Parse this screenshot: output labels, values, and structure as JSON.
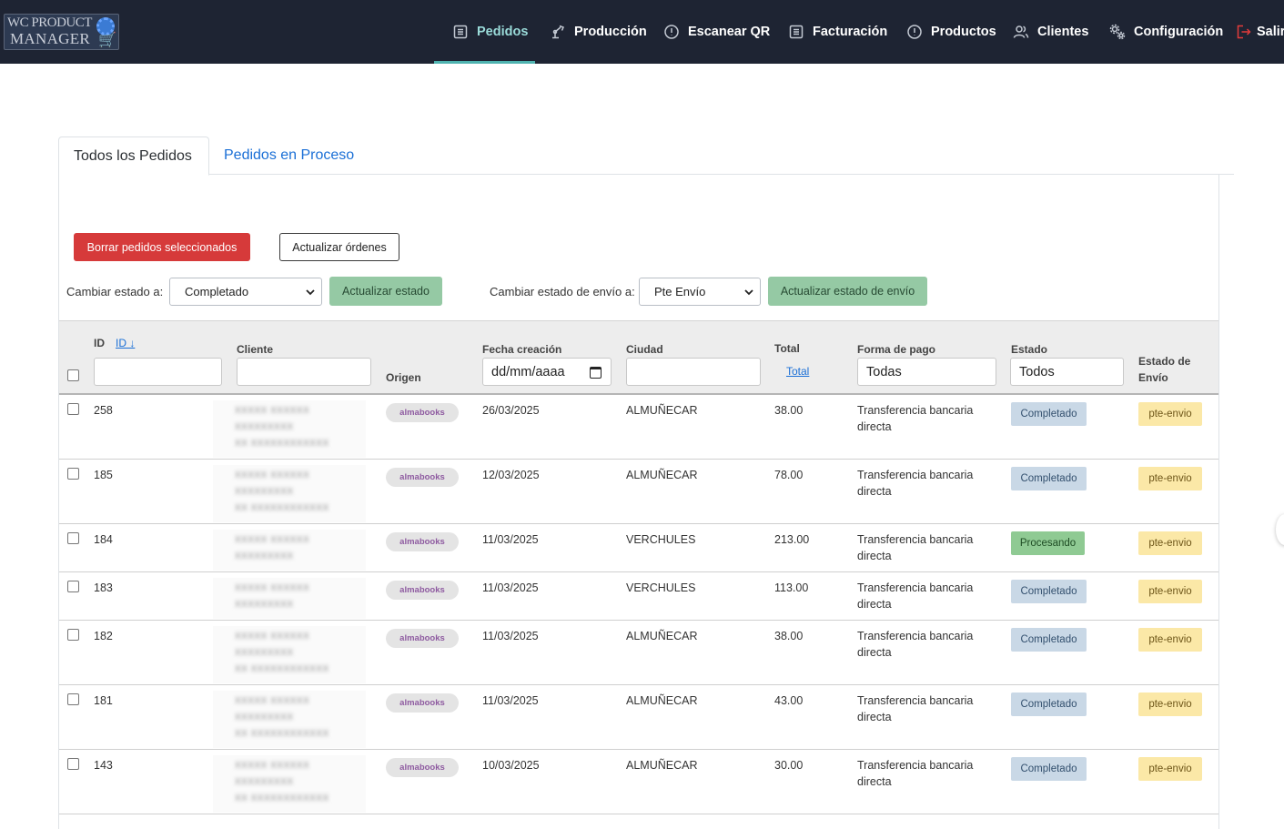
{
  "app": {
    "logo_line1": "WC PRODUCT",
    "logo_line2": "MANAGER"
  },
  "nav": {
    "pedidos": "Pedidos",
    "produccion": "Producción",
    "escanear": "Escanear QR",
    "facturacion": "Facturación",
    "productos": "Productos",
    "clientes": "Clientes",
    "configuracion": "Configuración",
    "salir": "Salir"
  },
  "tabs": {
    "todos": "Todos los Pedidos",
    "proceso": "Pedidos en Proceso"
  },
  "actions": {
    "delete_label": "Borrar pedidos seleccionados",
    "refresh_label": "Actualizar órdenes",
    "change_state_label": "Cambiar estado a:",
    "change_state_value": "Completado",
    "update_state_label": "Actualizar estado",
    "change_ship_label": "Cambiar estado de envío a:",
    "change_ship_value": "Pte Envío",
    "update_ship_label": "Actualizar estado de envío"
  },
  "table": {
    "headers": {
      "id": "ID",
      "id_sort": "ID ↓",
      "cliente": "Cliente",
      "origen": "Origen",
      "fecha": "Fecha creación",
      "ciudad": "Ciudad",
      "total": "Total",
      "total_link": "Total",
      "pago": "Forma de pago",
      "estado": "Estado",
      "envio_1": "Estado de",
      "envio_2": "Envío"
    },
    "filters": {
      "id": "",
      "cliente": "",
      "fecha": "dd/mm/aaaa",
      "ciudad": "",
      "pago": "Todas",
      "estado": "Todos"
    },
    "rows": [
      {
        "id": "258",
        "origin": "almabooks",
        "date": "26/03/2025",
        "city": "ALMUÑECAR",
        "total": "38.00",
        "payment": "Transferencia bancaria directa",
        "status": "Completado",
        "shipping": "pte-envio"
      },
      {
        "id": "185",
        "origin": "almabooks",
        "date": "12/03/2025",
        "city": "ALMUÑECAR",
        "total": "78.00",
        "payment": "Transferencia bancaria directa",
        "status": "Completado",
        "shipping": "pte-envio"
      },
      {
        "id": "184",
        "origin": "almabooks",
        "date": "11/03/2025",
        "city": "VERCHULES",
        "total": "213.00",
        "payment": "Transferencia bancaria directa",
        "status": "Procesando",
        "shipping": "pte-envio"
      },
      {
        "id": "183",
        "origin": "almabooks",
        "date": "11/03/2025",
        "city": "VERCHULES",
        "total": "113.00",
        "payment": "Transferencia bancaria directa",
        "status": "Completado",
        "shipping": "pte-envio"
      },
      {
        "id": "182",
        "origin": "almabooks",
        "date": "11/03/2025",
        "city": "ALMUÑECAR",
        "total": "38.00",
        "payment": "Transferencia bancaria directa",
        "status": "Completado",
        "shipping": "pte-envio"
      },
      {
        "id": "181",
        "origin": "almabooks",
        "date": "11/03/2025",
        "city": "ALMUÑECAR",
        "total": "43.00",
        "payment": "Transferencia bancaria directa",
        "status": "Completado",
        "shipping": "pte-envio"
      },
      {
        "id": "143",
        "origin": "almabooks",
        "date": "10/03/2025",
        "city": "ALMUÑECAR",
        "total": "30.00",
        "payment": "Transferencia bancaria directa",
        "status": "Completado",
        "shipping": "pte-envio"
      }
    ]
  },
  "colors": {
    "nav_bg": "#1e2433",
    "nav_active": "#9adbd9",
    "danger": "#d63a3a",
    "success_soft": "#95c9a4",
    "link": "#1a6fd6",
    "status_completado": "#c9d8e6",
    "status_procesando": "#8fca93",
    "shipping_pending": "#fbe8a7"
  }
}
